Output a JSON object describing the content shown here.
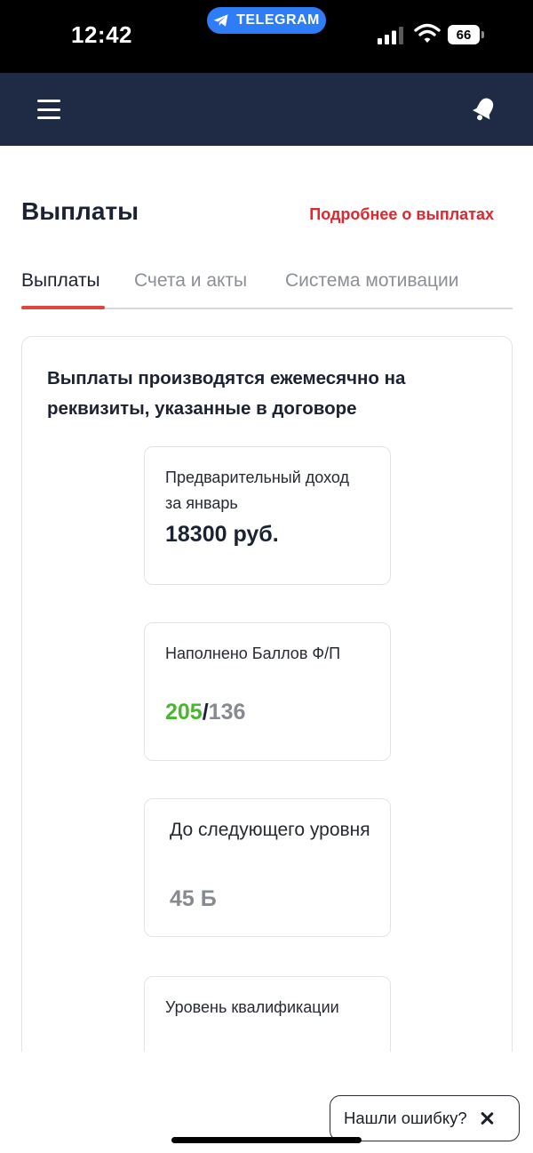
{
  "status_bar": {
    "time": "12:42",
    "app_pill": {
      "label": "TELEGRAM",
      "icon": "telegram-plane-icon",
      "color": "#2f7df6"
    },
    "signal_icon": "cellular-signal-icon",
    "wifi_icon": "wifi-icon",
    "battery_level": "66"
  },
  "header": {
    "background": "#1f2b44",
    "menu_icon": "hamburger-menu-icon",
    "notification_icon": "bell-icon"
  },
  "page": {
    "title": "Выплаты",
    "details_link": "Подробнее о выплатах",
    "accent_color": "#e0262f"
  },
  "tabs": [
    {
      "label": "Выплаты",
      "active": true
    },
    {
      "label": "Счета и акты",
      "active": false
    },
    {
      "label": "Система мотивации",
      "active": false
    }
  ],
  "panel": {
    "heading": "Выплаты производятся ежемесячно на реквизиты, указанные в договоре",
    "cards": [
      {
        "label": "Предварительный доход за январь",
        "value": "18300 руб."
      },
      {
        "label": "Наполнено Баллов Ф/П",
        "value_primary": "205",
        "value_separator": "/",
        "value_secondary": "136"
      },
      {
        "label": "До следующего уровня",
        "value": "45 Б"
      },
      {
        "label": "Уровень квалификации"
      }
    ]
  },
  "report_button": {
    "label": "Нашли ошибку?",
    "close_icon": "close-icon"
  }
}
